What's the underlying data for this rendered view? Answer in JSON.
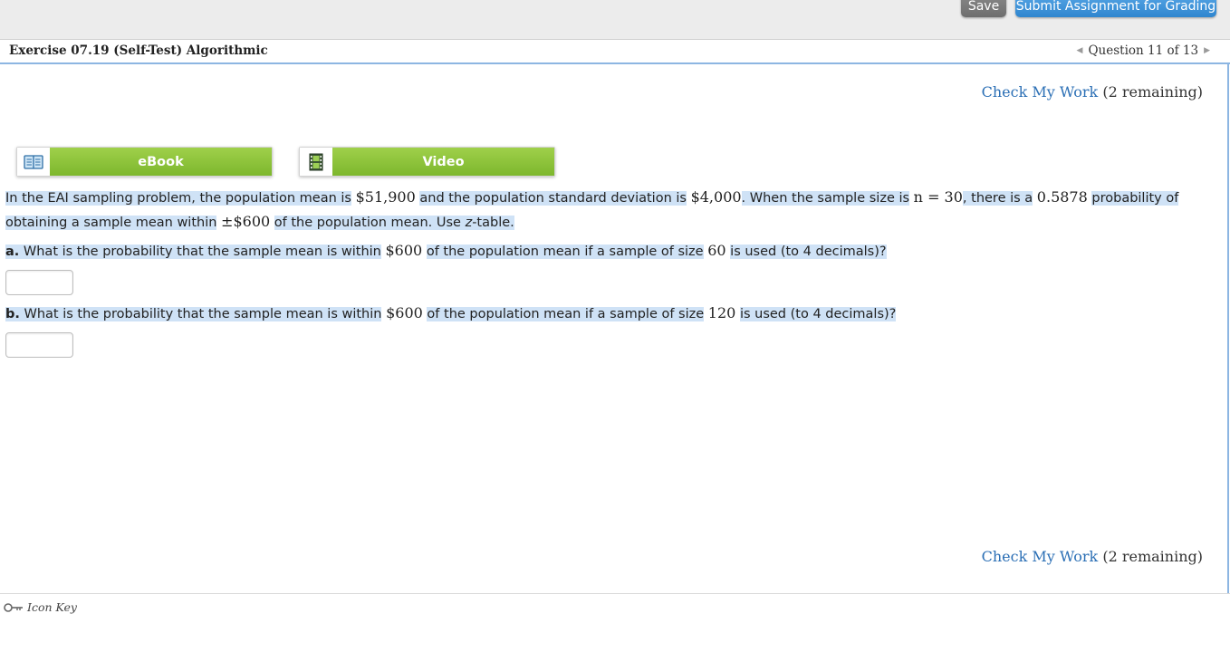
{
  "toolbar": {
    "save_label": "Save",
    "submit_label": "Submit Assignment for Grading"
  },
  "header": {
    "exercise_title": "Exercise 07.19 (Self-Test) Algorithmic",
    "question_nav": "Question 11 of 13",
    "prev_icon": "triangle-left-icon",
    "next_icon": "triangle-right-icon"
  },
  "check_my_work": {
    "link_label": "Check My Work",
    "remaining": "(2 remaining)"
  },
  "media": {
    "ebook_label": "eBook",
    "ebook_icon": "book-icon",
    "video_label": "Video",
    "video_icon": "film-icon"
  },
  "question": {
    "intro_1": "In the EAI sampling problem, the population mean is",
    "pop_mean": "$51,900",
    "intro_2": "and the population standard deviation is",
    "pop_sd": "$4,000",
    "intro_3": ". When the sample size is",
    "n_expr": "n = 30",
    "intro_4": ", there is a",
    "prob": "0.5878",
    "intro_5": "probability of obtaining a sample mean within",
    "within": "±$600",
    "intro_6": "of the population mean. Use",
    "ztable_z": "z",
    "intro_7": "-table.",
    "part_a_label": "a.",
    "part_a_text_1": "What is the probability that the sample mean is within",
    "part_a_amount": "$600",
    "part_a_text_2": "of the population mean if a sample of size",
    "part_a_size": "60",
    "part_a_text_3": "is used (to 4 decimals)?",
    "part_a_value": "",
    "part_b_label": "b.",
    "part_b_text_1": "What is the probability that the sample mean is within",
    "part_b_amount": "$600",
    "part_b_text_2": "of the population mean if a sample of size",
    "part_b_size": "120",
    "part_b_text_3": "is used (to 4 decimals)?",
    "part_b_value": ""
  },
  "footer": {
    "icon_key_label": "Icon Key",
    "icon_key_icon": "key-icon"
  },
  "colors": {
    "highlight": "#cfe2f6",
    "link": "#2b6fb5",
    "submit": "#3a8fd6",
    "media_green": "#8cc43b"
  }
}
